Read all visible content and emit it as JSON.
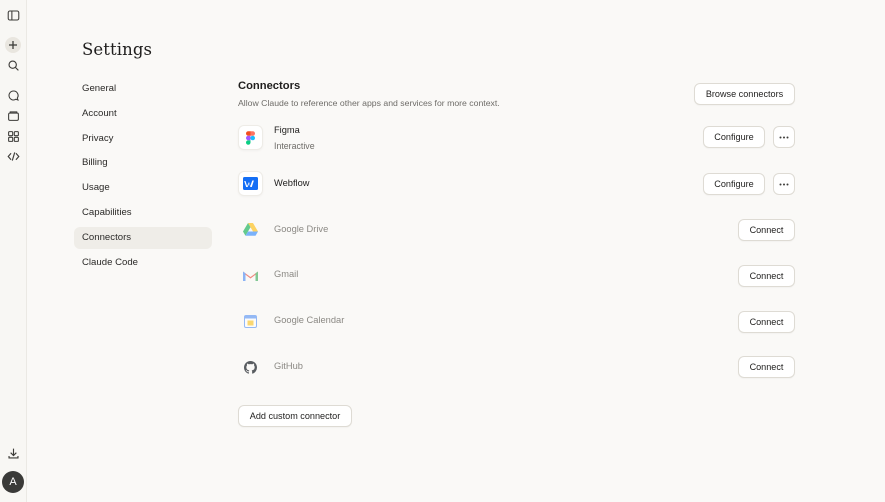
{
  "page": {
    "title": "Settings"
  },
  "nav": {
    "items": [
      {
        "label": "General",
        "active": false
      },
      {
        "label": "Account",
        "active": false
      },
      {
        "label": "Privacy",
        "active": false
      },
      {
        "label": "Billing",
        "active": false
      },
      {
        "label": "Usage",
        "active": false
      },
      {
        "label": "Capabilities",
        "active": false
      },
      {
        "label": "Connectors",
        "active": true
      },
      {
        "label": "Claude Code",
        "active": false
      }
    ]
  },
  "connectors": {
    "title": "Connectors",
    "description": "Allow Claude to reference other apps and services for more context.",
    "browse_label": "Browse connectors",
    "add_custom_label": "Add custom connector",
    "items": [
      {
        "name": "Figma",
        "subtitle": "Interactive",
        "action": "Configure",
        "icon": "figma-icon",
        "connected": true
      },
      {
        "name": "Webflow",
        "subtitle": "",
        "action": "Configure",
        "icon": "webflow-icon",
        "connected": true
      },
      {
        "name": "Google Drive",
        "subtitle": "",
        "action": "Connect",
        "icon": "google-drive-icon",
        "connected": false
      },
      {
        "name": "Gmail",
        "subtitle": "",
        "action": "Connect",
        "icon": "gmail-icon",
        "connected": false
      },
      {
        "name": "Google Calendar",
        "subtitle": "",
        "action": "Connect",
        "icon": "google-calendar-icon",
        "connected": false
      },
      {
        "name": "GitHub",
        "subtitle": "",
        "action": "Connect",
        "icon": "github-icon",
        "connected": false
      }
    ]
  },
  "sidebar": {
    "icons": [
      "sidebar-toggle-icon",
      "new-chat-icon",
      "search-icon",
      "chats-icon",
      "projects-icon",
      "artifacts-icon",
      "code-icon",
      "download-icon"
    ],
    "avatar_initial": "A"
  }
}
